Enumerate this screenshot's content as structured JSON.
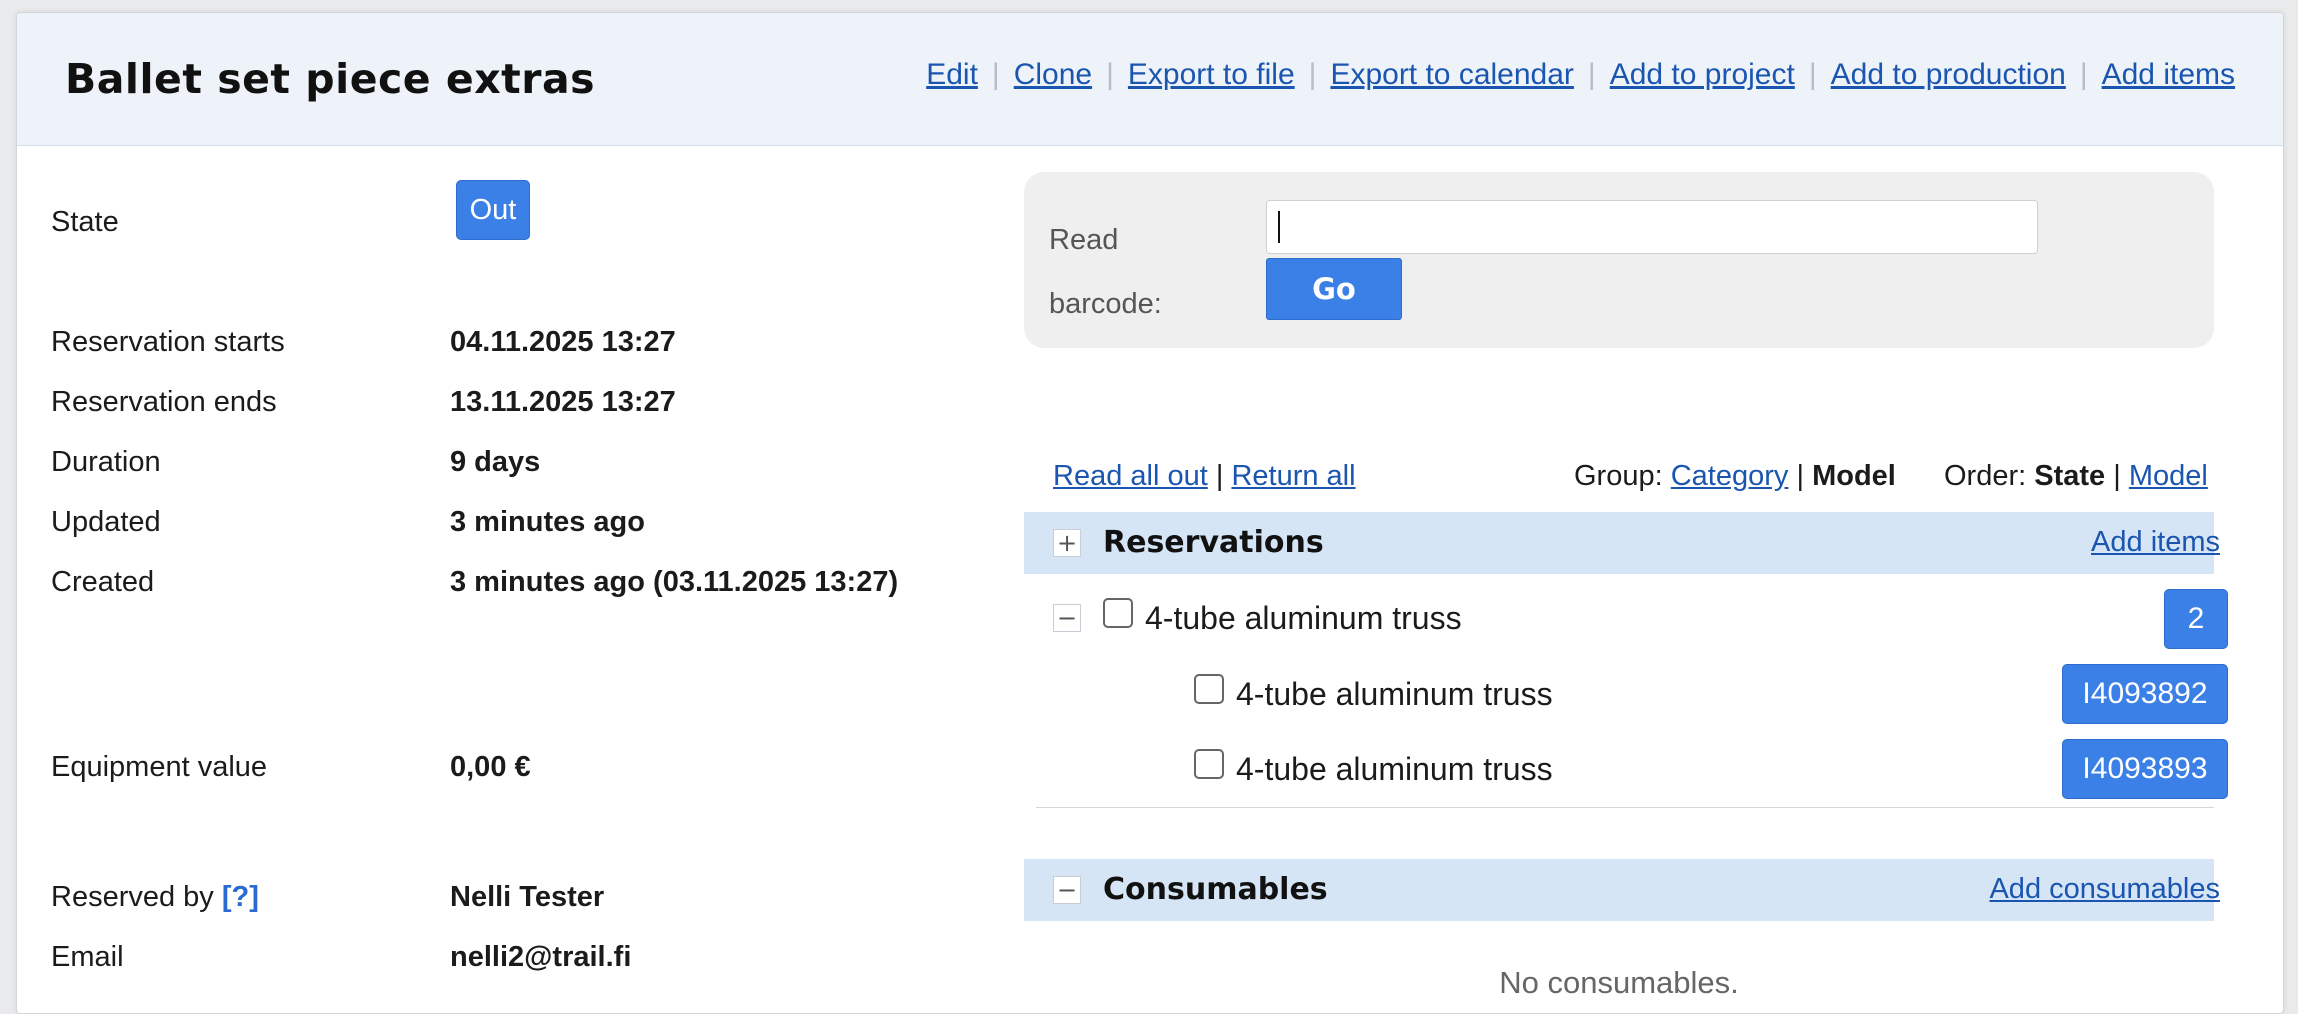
{
  "header": {
    "title": "Ballet set piece extras",
    "actions": [
      "Edit",
      "Clone",
      "Export to file",
      "Export to calendar",
      "Add to project",
      "Add to production",
      "Add items"
    ]
  },
  "info": {
    "state_label": "State",
    "state_value": "Out",
    "starts_label": "Reservation starts",
    "starts_value": "04.11.2025 13:27",
    "ends_label": "Reservation ends",
    "ends_value": "13.11.2025 13:27",
    "duration_label": "Duration",
    "duration_value": "9 days",
    "updated_label": "Updated",
    "updated_value": "3 minutes ago",
    "created_label": "Created",
    "created_value": "3 minutes ago (03.11.2025 13:27)",
    "equipment_label": "Equipment value",
    "equipment_value": "0,00 €",
    "reserved_label": "Reserved by",
    "reserved_help": "[?]",
    "reserved_value": "Nelli Tester",
    "email_label": "Email",
    "email_value": "nelli2@trail.fi"
  },
  "barcode": {
    "label_line1": "Read",
    "label_line2": "barcode:",
    "input_value": "",
    "go_label": "Go"
  },
  "toolbar": {
    "read_all_out": "Read all out",
    "sep": "|",
    "return_all": "Return all",
    "group_label": "Group:",
    "group_category": "Category",
    "group_model": "Model",
    "order_label": "Order:",
    "order_state": "State",
    "order_model": "Model"
  },
  "reservations": {
    "toggle": "+",
    "title": "Reservations",
    "add_link": "Add items",
    "group": {
      "toggle": "−",
      "name": "4-tube aluminum truss",
      "count": "2",
      "items": [
        {
          "name": "4-tube aluminum truss",
          "code": "I4093892"
        },
        {
          "name": "4-tube aluminum truss",
          "code": "I4093893"
        }
      ]
    }
  },
  "consumables": {
    "toggle": "−",
    "title": "Consumables",
    "add_link": "Add consumables",
    "empty_text": "No consumables."
  }
}
